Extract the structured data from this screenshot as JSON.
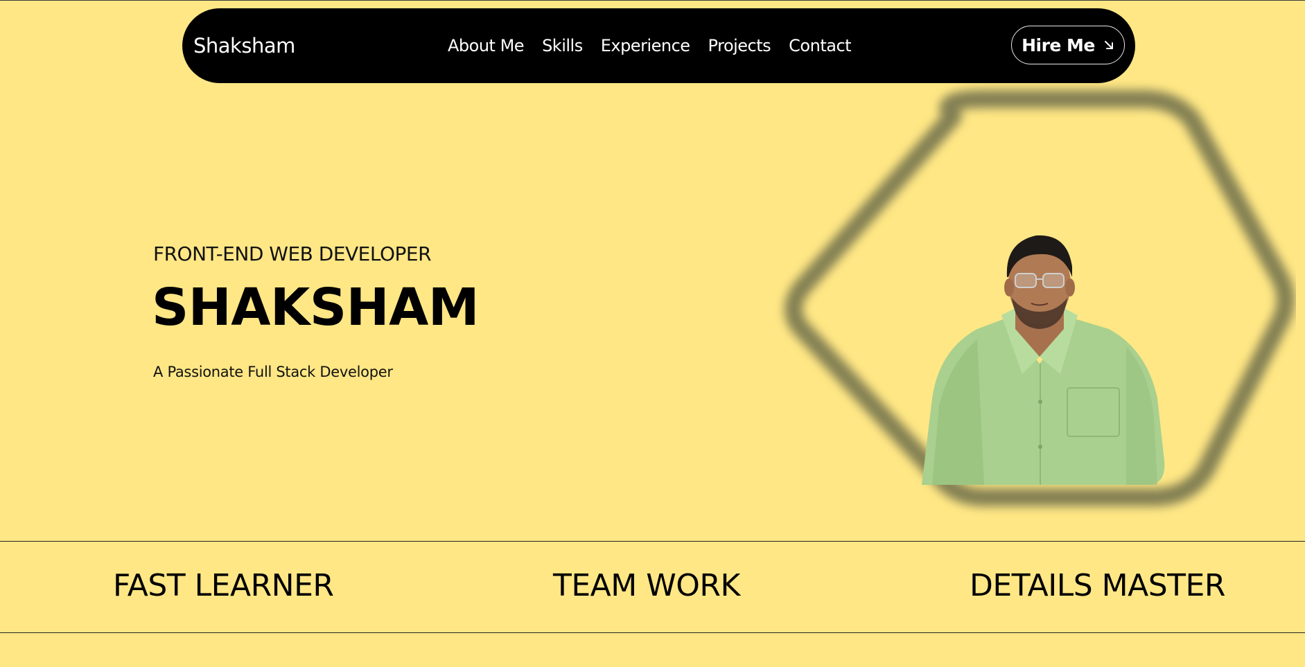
{
  "nav": {
    "brand": "Shaksham",
    "links": [
      "About Me",
      "Skills",
      "Experience",
      "Projects",
      "Contact"
    ],
    "cta_label": "Hire Me",
    "cta_icon": "arrow-down-right-icon"
  },
  "hero": {
    "eyebrow": "FRONT-END WEB DEVELOPER",
    "name": "SHAKSHAM",
    "tagline": "A Passionate Full Stack Developer"
  },
  "features": [
    "FAST LEARNER",
    "TEAM WORK",
    "DETAILS MASTER"
  ],
  "colors": {
    "background": "#FFE785",
    "navbar": "#000000",
    "text": "#000000",
    "hexagon": "#7a7a4a",
    "shirt": "#a9d08e"
  }
}
